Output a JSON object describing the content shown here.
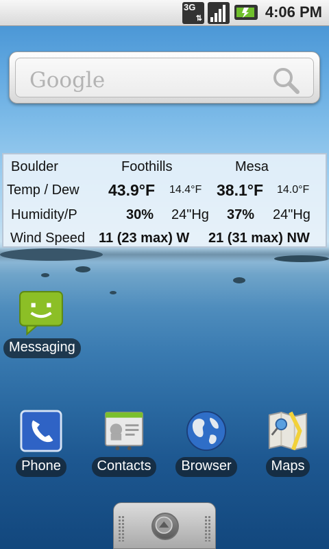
{
  "status_bar": {
    "network_label": "3G",
    "time": "4:06 PM",
    "icons": [
      "3g-data-icon",
      "signal-strength-icon",
      "battery-charging-icon"
    ]
  },
  "search_widget": {
    "logo_text": "Google",
    "icon": "search-icon"
  },
  "weather": {
    "header": {
      "station": "Boulder",
      "col1": "Foothills",
      "col2": "Mesa"
    },
    "rows": {
      "temp": {
        "label": "Temp / Dew",
        "v1": "43.9°F",
        "d1": "14.4°F",
        "v2": "38.1°F",
        "d2": "14.0°F"
      },
      "humidity": {
        "label": "Humidity/P",
        "v1": "30%",
        "d1": "24\"Hg",
        "v2": "37%",
        "d2": "24\"Hg"
      },
      "wind": {
        "label": "Wind Speed",
        "v1": "11 (23 max) W",
        "v2": "21 (31 max) NW"
      }
    }
  },
  "desktop": {
    "messaging": {
      "label": "Messaging",
      "icon": "messaging-icon"
    }
  },
  "dock_apps": [
    {
      "label": "Phone",
      "icon": "phone-icon"
    },
    {
      "label": "Contacts",
      "icon": "contacts-icon"
    },
    {
      "label": "Browser",
      "icon": "browser-globe-icon"
    },
    {
      "label": "Maps",
      "icon": "maps-icon"
    }
  ],
  "drawer": {
    "icon": "app-drawer-arrow-icon"
  },
  "colors": {
    "messaging_green": "#8cbf26",
    "phone_blue": "#2f63c5",
    "label_bg": "#1e2a34"
  }
}
